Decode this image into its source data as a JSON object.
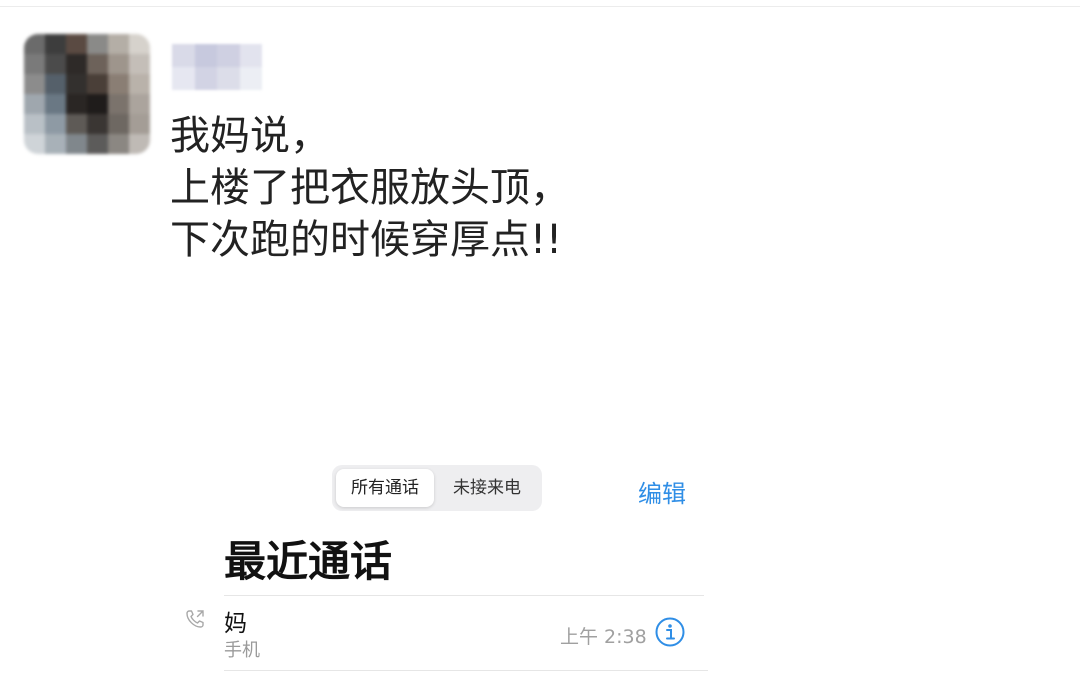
{
  "post": {
    "lines": [
      "我妈说，",
      "上楼了把衣服放头顶，",
      "下次跑的时候穿厚点!!"
    ]
  },
  "phone": {
    "segmented": {
      "all_calls": "所有通话",
      "missed_calls": "未接来电"
    },
    "edit_label": "编辑",
    "section_title": "最近通话",
    "call": {
      "name": "妈",
      "type": "手机",
      "time": "上午 2:38"
    }
  },
  "colors": {
    "accent": "#2f8ee6",
    "text": "#222222",
    "secondary": "#9a9a9a"
  },
  "icons": {
    "call": "phone-outgoing-icon",
    "info": "info-circle-icon"
  }
}
